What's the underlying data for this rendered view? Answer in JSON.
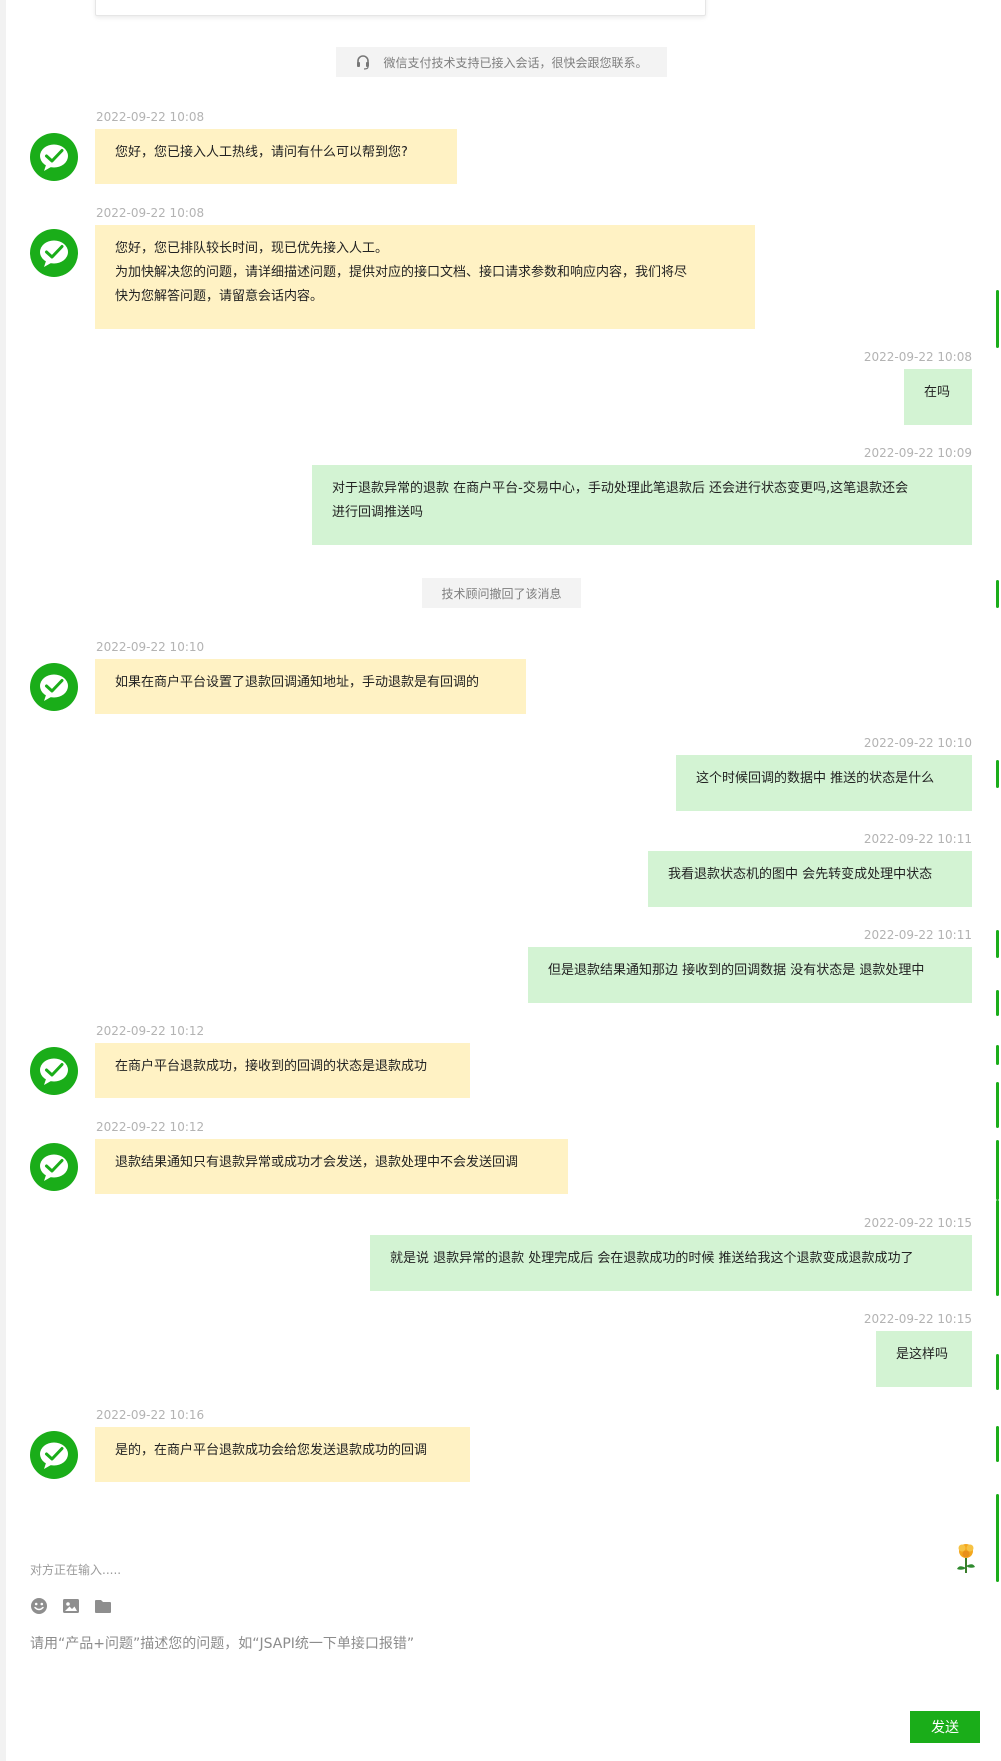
{
  "top_notice": "微信支付技术支持已接入会话，很快会跟您联系。",
  "recall_notice": "技术顾问撤回了该消息",
  "messages": [
    {
      "time": "2022-09-22 10:08",
      "lines": [
        "您好，您已接入人工热线，请问有什么可以帮到您?"
      ]
    },
    {
      "time": "2022-09-22 10:08",
      "lines": [
        "您好，您已排队较长时间，现已优先接入人工。",
        "为加快解决您的问题，请详细描述问题，提供对应的接口文档、接口请求参数和响应内容，我们将尽",
        "快为您解答问题，请留意会话内容。"
      ]
    },
    {
      "time": "2022-09-22 10:08",
      "lines": [
        "在吗"
      ]
    },
    {
      "time": "2022-09-22 10:09",
      "lines": [
        "对于退款异常的退款 在商户平台-交易中心，手动处理此笔退款后 还会进行状态变更吗,这笔退款还会",
        "进行回调推送吗"
      ]
    },
    {
      "time": "2022-09-22 10:10",
      "lines": [
        "如果在商户平台设置了退款回调通知地址，手动退款是有回调的"
      ]
    },
    {
      "time": "2022-09-22 10:10",
      "lines": [
        "这个时候回调的数据中 推送的状态是什么"
      ]
    },
    {
      "time": "2022-09-22 10:11",
      "lines": [
        "我看退款状态机的图中 会先转变成处理中状态"
      ]
    },
    {
      "time": "2022-09-22 10:11",
      "lines": [
        "但是退款结果通知那边 接收到的回调数据 没有状态是 退款处理中"
      ]
    },
    {
      "time": "2022-09-22 10:12",
      "lines": [
        "在商户平台退款成功，接收到的回调的状态是退款成功"
      ]
    },
    {
      "time": "2022-09-22 10:12",
      "lines": [
        "退款结果通知只有退款异常或成功才会发送，退款处理中不会发送回调"
      ]
    },
    {
      "time": "2022-09-22 10:15",
      "lines": [
        "就是说 退款异常的退款 处理完成后 会在退款成功的时候 推送给我这个退款变成退款成功了"
      ]
    },
    {
      "time": "2022-09-22 10:15",
      "lines": [
        "是这样吗"
      ]
    },
    {
      "time": "2022-09-22 10:16",
      "lines": [
        "是的，在商户平台退款成功会给您发送退款成功的回调"
      ]
    }
  ],
  "composer": {
    "typing_status": "对方正在输入.....",
    "placeholder": "请用“产品+问题”描述您的问题，如“JSAPI统一下单接口报错”",
    "send_label": "发送"
  },
  "icons": {
    "avatar": "wechat-pay-logo-icon",
    "notice": "headset-icon",
    "emoji": "emoji-icon",
    "image": "image-icon",
    "file": "folder-icon",
    "flower": "flower-icon"
  },
  "colors": {
    "brand": "#1aad19",
    "agent_bubble": "#fff2c4",
    "user_bubble": "#d3f3d3",
    "timestamp": "#b3b3b3"
  }
}
